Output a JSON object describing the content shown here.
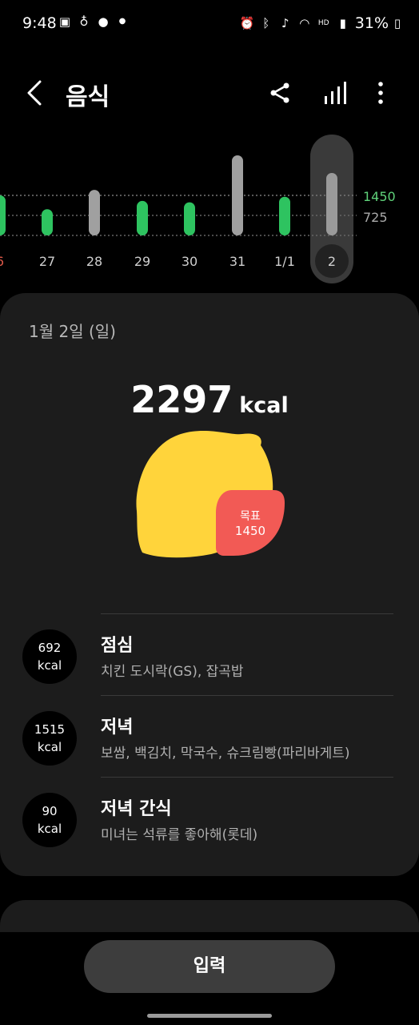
{
  "status": {
    "time": "9:48",
    "battery": "31%",
    "left_icons": [
      "image-icon",
      "chat-app-icon",
      "talk-icon",
      "dot-icon"
    ],
    "right_icons": [
      "alarm-icon",
      "bluetooth-icon",
      "mute-icon",
      "wifi-icon",
      "hd-voice-icon",
      "signal-icon",
      "battery-icon"
    ]
  },
  "appbar": {
    "title": "음식",
    "back_icon": "chevron-left-icon",
    "actions": [
      "share-icon",
      "chart-icon",
      "more-vertical-icon"
    ]
  },
  "chart_data": {
    "type": "bar",
    "categories": [
      "6",
      "27",
      "28",
      "29",
      "30",
      "31",
      "1/1",
      "2"
    ],
    "values": [
      1450,
      950,
      1650,
      1250,
      1200,
      2900,
      1400,
      2297
    ],
    "goal": 1450,
    "goal_label": "1450",
    "half_label": "725",
    "selected": "2",
    "colors": {
      "over": "#a0a0a0",
      "met": "#2ec360",
      "goal_line": "#5fd17a",
      "first_label": "#e05a4a"
    }
  },
  "card": {
    "date": "1월 2일 (일)",
    "total_value": "2297",
    "total_unit": "kcal",
    "goal_title": "목표",
    "goal_value": "1450",
    "colors": {
      "lemon": "#ffd43b",
      "goal_badge": "#f25a55"
    }
  },
  "meals": [
    {
      "calories": "692",
      "unit": "kcal",
      "name": "점심",
      "items": "치킨 도시락(GS), 잡곡밥"
    },
    {
      "calories": "1515",
      "unit": "kcal",
      "name": "저녁",
      "items": "보쌈, 백김치, 막국수, 슈크림빵(파리바게트)"
    },
    {
      "calories": "90",
      "unit": "kcal",
      "name": "저녁 간식",
      "items": "미녀는 석류를 좋아해(롯데)"
    }
  ],
  "input_button": "입력"
}
